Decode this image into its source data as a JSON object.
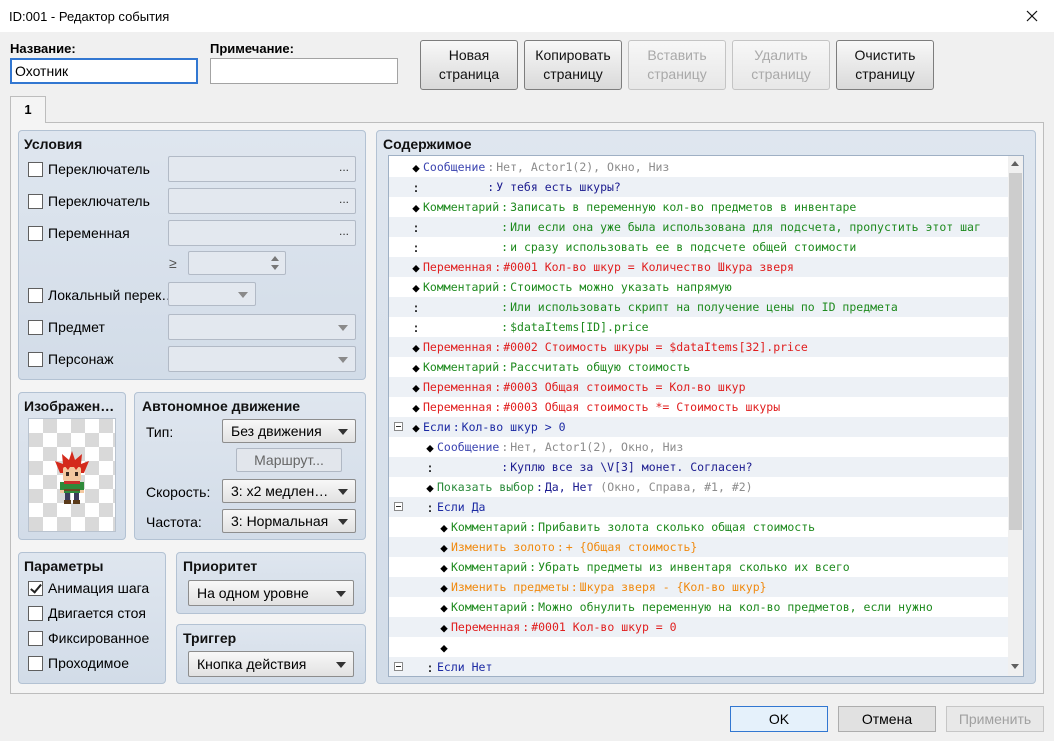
{
  "window": {
    "title": "ID:001 - Редактор события"
  },
  "header": {
    "name_label": "Название:",
    "name_value": "Охотник",
    "note_label": "Примечание:",
    "note_value": "",
    "buttons": [
      {
        "line1": "Новая",
        "line2": "страница",
        "enabled": true
      },
      {
        "line1": "Копировать",
        "line2": "страницу",
        "enabled": true
      },
      {
        "line1": "Вставить",
        "line2": "страницу",
        "enabled": false
      },
      {
        "line1": "Удалить",
        "line2": "страницу",
        "enabled": false
      },
      {
        "line1": "Очистить",
        "line2": "страницу",
        "enabled": true
      }
    ]
  },
  "tabs": [
    {
      "label": "1"
    }
  ],
  "conditions": {
    "title": "Условия",
    "switch1": {
      "label": "Переключатель",
      "checked": false,
      "button": "..."
    },
    "switch2": {
      "label": "Переключатель",
      "checked": false,
      "button": "..."
    },
    "variable": {
      "label": "Переменная",
      "checked": false,
      "button": "...",
      "operator": "≥",
      "value": ""
    },
    "self_switch": {
      "label": "Локальный перек…",
      "checked": false,
      "selected": ""
    },
    "item": {
      "label": "Предмет",
      "checked": false,
      "selected": ""
    },
    "actor": {
      "label": "Персонаж",
      "checked": false,
      "selected": ""
    }
  },
  "image": {
    "title": "Изображен…",
    "sprite": "character-sprite"
  },
  "movement": {
    "title": "Автономное движение",
    "type_label": "Тип:",
    "type_value": "Без движения",
    "route_button": "Маршрут...",
    "speed_label": "Скорость:",
    "speed_value": "3: x2 медлен…",
    "freq_label": "Частота:",
    "freq_value": "3: Нормальная"
  },
  "options": {
    "title": "Параметры",
    "items": [
      {
        "label": "Анимация шага",
        "checked": true
      },
      {
        "label": "Двигается стоя",
        "checked": false
      },
      {
        "label": "Фиксированное",
        "checked": false
      },
      {
        "label": "Проходимое",
        "checked": false
      }
    ]
  },
  "priority": {
    "title": "Приоритет",
    "value": "На одном уровне"
  },
  "trigger": {
    "title": "Триггер",
    "value": "Кнопка действия"
  },
  "content": {
    "title": "Содержимое",
    "rows": [
      {
        "depth": 0,
        "marker": "◆",
        "label": "Сообщение",
        "label_color": "#3b44b0",
        "sep": ":",
        "args": [
          {
            "text": "Нет, Actor1(2), Окно, Низ",
            "color": "#8c8c8c"
          }
        ]
      },
      {
        "depth": 0,
        "marker": ":",
        "sep": ":",
        "args": [
          {
            "text": "У тебя есть шкуры?",
            "color": "#1b1b8f"
          }
        ]
      },
      {
        "depth": 0,
        "marker": "◆",
        "label": "Комментарий",
        "label_color": "#1e8a1e",
        "sep": ":",
        "args": [
          {
            "text": "Записать в переменную кол-во предметов в инвентаре",
            "color": "#1e8a1e"
          }
        ]
      },
      {
        "depth": 0,
        "marker": ":",
        "sep": ":",
        "args": [
          {
            "text": "Или если она уже была использована для подсчета, пропустить этот шаг",
            "color": "#1e8a1e"
          }
        ]
      },
      {
        "depth": 0,
        "marker": ":",
        "sep": ":",
        "args": [
          {
            "text": "и сразу использовать ее в подсчете общей стоимости",
            "color": "#1e8a1e"
          }
        ]
      },
      {
        "depth": 0,
        "marker": "◆",
        "label": "Переменная",
        "label_color": "#e01e1e",
        "sep": ":",
        "args": [
          {
            "text": "#0001 Кол-во шкур = Количество Шкура зверя",
            "color": "#e01e1e"
          }
        ]
      },
      {
        "depth": 0,
        "marker": "◆",
        "label": "Комментарий",
        "label_color": "#1e8a1e",
        "sep": ":",
        "args": [
          {
            "text": "Стоимость можно указать напрямую",
            "color": "#1e8a1e"
          }
        ]
      },
      {
        "depth": 0,
        "marker": ":",
        "sep": ":",
        "args": [
          {
            "text": "Или использовать скрипт на получение цены по ID предмета",
            "color": "#1e8a1e"
          }
        ]
      },
      {
        "depth": 0,
        "marker": ":",
        "sep": ":",
        "args": [
          {
            "text": "$dataItems[ID].price",
            "color": "#1e8a1e"
          }
        ]
      },
      {
        "depth": 0,
        "marker": "◆",
        "label": "Переменная",
        "label_color": "#e01e1e",
        "sep": ":",
        "args": [
          {
            "text": "#0002 Стоимость шкуры = $dataItems[32].price",
            "color": "#e01e1e"
          }
        ]
      },
      {
        "depth": 0,
        "marker": "◆",
        "label": "Комментарий",
        "label_color": "#1e8a1e",
        "sep": ":",
        "args": [
          {
            "text": "Рассчитать общую стоимость",
            "color": "#1e8a1e"
          }
        ]
      },
      {
        "depth": 0,
        "marker": "◆",
        "label": "Переменная",
        "label_color": "#e01e1e",
        "sep": ":",
        "args": [
          {
            "text": "#0003 Общая стоимость = Кол-во шкур",
            "color": "#e01e1e"
          }
        ]
      },
      {
        "depth": 0,
        "marker": "◆",
        "label": "Переменная",
        "label_color": "#e01e1e",
        "sep": ":",
        "args": [
          {
            "text": "#0003 Общая стоимость *= Стоимость шкуры",
            "color": "#e01e1e"
          }
        ]
      },
      {
        "depth": 0,
        "marker": "◆",
        "toggle": "collapse-icon",
        "label": "Если",
        "label_color": "#1c2aa3",
        "sep": ":",
        "args": [
          {
            "text": "Кол-во шкур > 0",
            "color": "#1c2aa3"
          }
        ]
      },
      {
        "depth": 1,
        "marker": "◆",
        "label": "Сообщение",
        "label_color": "#3b44b0",
        "sep": ":",
        "args": [
          {
            "text": "Нет, Actor1(2), Окно, Низ",
            "color": "#8c8c8c"
          }
        ]
      },
      {
        "depth": 1,
        "marker": ":",
        "sep": ":",
        "args": [
          {
            "text": "Куплю все за \\V[3] монет. Согласен?",
            "color": "#1b1b8f"
          }
        ]
      },
      {
        "depth": 1,
        "marker": "◆",
        "label": "Показать выбор",
        "label_color": "#2a8a3a",
        "sep": ":",
        "args": [
          {
            "text": "Да, Нет",
            "color": "#1b1b8f"
          },
          {
            "text": " (Окно, Справа, #1, #2)",
            "color": "#8c8c8c"
          }
        ]
      },
      {
        "depth": 1,
        "marker": ":",
        "toggle": "collapse-icon",
        "args": [
          {
            "text": "Если Да",
            "color": "#1c2aa3"
          }
        ]
      },
      {
        "depth": 2,
        "marker": "◆",
        "label": "Комментарий",
        "label_color": "#1e8a1e",
        "sep": ":",
        "args": [
          {
            "text": "Прибавить золота сколько общая стоимость",
            "color": "#1e8a1e"
          }
        ]
      },
      {
        "depth": 2,
        "marker": "◆",
        "label": "Изменить золото",
        "label_color": "#f08a10",
        "sep": ":",
        "args": [
          {
            "text": "+ {Общая стоимость}",
            "color": "#f08a10"
          }
        ]
      },
      {
        "depth": 2,
        "marker": "◆",
        "label": "Комментарий",
        "label_color": "#1e8a1e",
        "sep": ":",
        "args": [
          {
            "text": "Убрать предметы из инвентаря сколько их всего",
            "color": "#1e8a1e"
          }
        ]
      },
      {
        "depth": 2,
        "marker": "◆",
        "label": "Изменить предметы",
        "label_color": "#f08a10",
        "sep": ":",
        "args": [
          {
            "text": "Шкура зверя - {Кол-во шкур}",
            "color": "#f08a10"
          }
        ]
      },
      {
        "depth": 2,
        "marker": "◆",
        "label": "Комментарий",
        "label_color": "#1e8a1e",
        "sep": ":",
        "args": [
          {
            "text": "Можно обнулить переменную на кол-во предметов, если нужно",
            "color": "#1e8a1e"
          }
        ]
      },
      {
        "depth": 2,
        "marker": "◆",
        "label": "Переменная",
        "label_color": "#e01e1e",
        "sep": ":",
        "args": [
          {
            "text": "#0001 Кол-во шкур = 0",
            "color": "#e01e1e"
          }
        ]
      },
      {
        "depth": 2,
        "marker": "◆"
      },
      {
        "depth": 1,
        "marker": ":",
        "toggle": "collapse-icon",
        "args": [
          {
            "text": "Если Нет",
            "color": "#1c2aa3"
          }
        ]
      }
    ]
  },
  "footer": {
    "ok": "OK",
    "cancel": "Отмена",
    "apply": "Применить",
    "apply_enabled": false
  },
  "colors": {
    "accent": "#3277d1",
    "group_bg": "#d8e1eb",
    "window_bg": "#f0f0f0"
  }
}
